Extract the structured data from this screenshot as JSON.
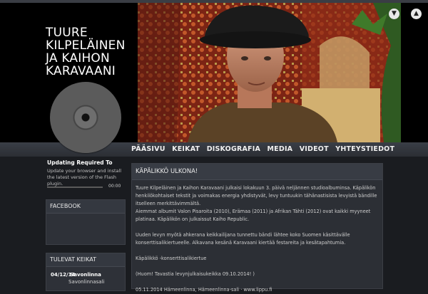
{
  "header": {
    "title_lines": [
      "TUURE",
      "KILPELÄINEN",
      "JA KAIHON",
      "KARAVAANI"
    ],
    "scroll_down_icon": "chevron-down-icon",
    "scroll_up_icon": "chevron-up-icon"
  },
  "nav": {
    "items": [
      "PÄÄSIVU",
      "KEIKAT",
      "DISKOGRAFIA",
      "MEDIA",
      "VIDEOT",
      "YHTEYSTIEDOT"
    ]
  },
  "player": {
    "title": "Updating Required To",
    "text": "Update your browser and install the latest version of the Flash plugin.",
    "time": "00:00"
  },
  "sidebar": {
    "facebook_title": "FACEBOOK",
    "gigs_title": "TULEVAT KEIKAT",
    "gigs": [
      {
        "date": "04/12/14",
        "venue": "Savonlinna",
        "detail": "Savonlinnasali"
      }
    ]
  },
  "post": {
    "title": "KÄPÄLIKKÖ ULKONA!",
    "p1": "Tuure Kilpeläinen ja Kaihon Karavaani julkaisi lokakuun 3. päivä neljännen studioalbuminsa. Käpälikön henkilökohtaiset tekstit ja voimakas energia yhdistyvät, levy tuntuukin tähänastisista levyistä bändille itselleen merkittävimmältä.",
    "p2": "Aiemmat albumit Valon Pisaroita (2010), Erämaa (2011) ja Afrikan Tähti (2012) ovat kaikki myyneet platinaa. Käpälikön on julkaissut Kaiho Republic.",
    "p3": "Uuden levyn myötä ahkerana keikkailijana tunnettu bändi lähtee koko Suomen käsittävälle konserttisalikiertueelle. Alkavana kesänä Karavaani kiertää festareita ja kesätapahtumia.",
    "p4": "Käpälikkö -konserttisalikiertue",
    "p5": "(Huom! Tavastia levynjulkaisukeikka 09.10.2014! )",
    "p6": "05.11.2014  Hämeenlinna, Hämeenlinna-sali   ·   www.lippu.fi"
  }
}
